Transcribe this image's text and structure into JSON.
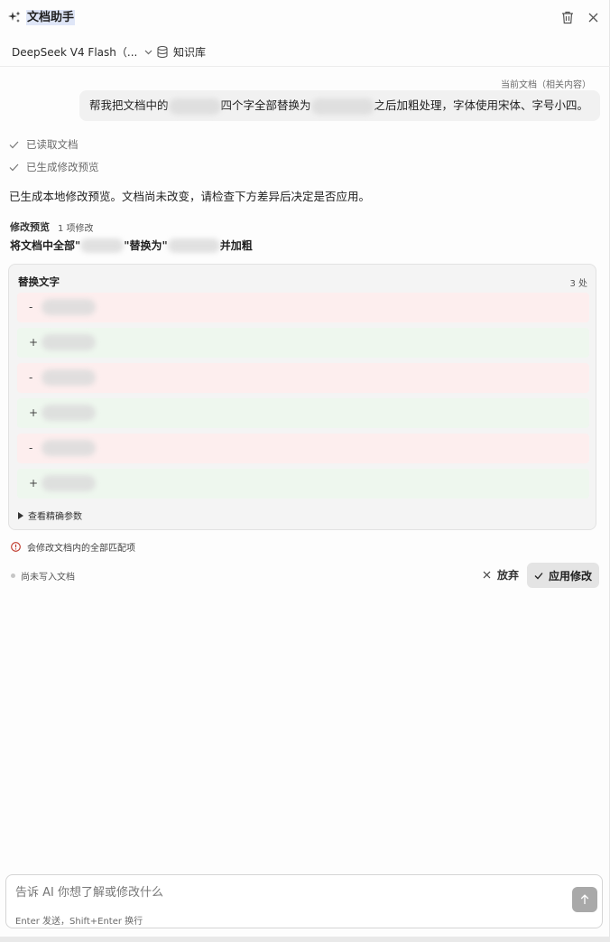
{
  "header": {
    "title": "文档助手",
    "icons": [
      "sparkle-icon",
      "trash-icon",
      "close-icon"
    ]
  },
  "toolbar": {
    "model_label": "DeepSeek V4 Flash（...",
    "knowledge_base_label": "知识库"
  },
  "conversation": {
    "context_tag": "当前文档（相关内容）",
    "user_message": {
      "part1": "帮我把文档中的",
      "part2": "四个字全部替换为",
      "part3": "之后加粗处理，字体使用宋体、字号小四。"
    },
    "steps": [
      "已读取文档",
      "已生成修改预览"
    ],
    "summary": "已生成本地修改预览。文档尚未改变，请检查下方差异后决定是否应用。"
  },
  "preview": {
    "label": "修改预览",
    "count": "1 项修改",
    "title_part1": "将文档中全部\"",
    "title_part2": "\"替换为\"",
    "title_part3": "并加粗",
    "card": {
      "heading": "替换文字",
      "count": "3 处",
      "rows": [
        {
          "type": "del",
          "sign": "-"
        },
        {
          "type": "add",
          "sign": "+"
        },
        {
          "type": "del",
          "sign": "-"
        },
        {
          "type": "add",
          "sign": "+"
        },
        {
          "type": "del",
          "sign": "-"
        },
        {
          "type": "add",
          "sign": "+"
        }
      ],
      "params_label": "查看精确参数"
    },
    "warning": "会修改文档内的全部匹配项",
    "status": "尚未写入文档",
    "discard_label": "放弃",
    "apply_label": "应用修改"
  },
  "composer": {
    "placeholder": "告诉 AI 你想了解或修改什么",
    "hint": "Enter 发送，Shift+Enter 换行"
  }
}
